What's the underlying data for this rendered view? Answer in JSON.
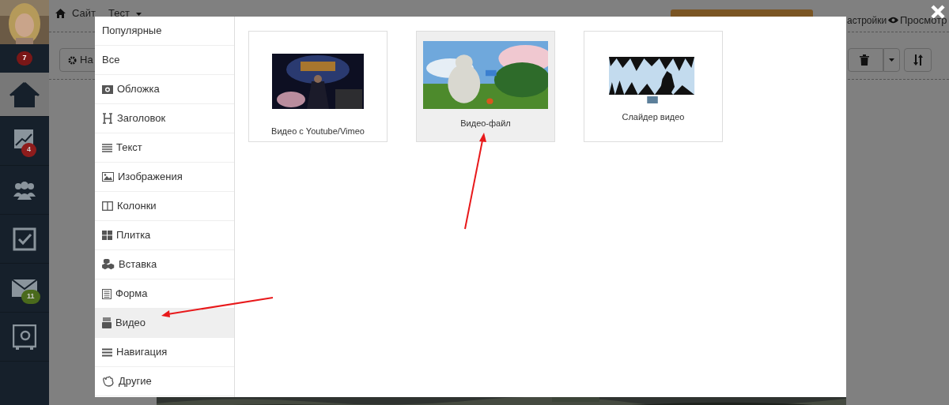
{
  "sidebar": {
    "profile_badge": "7",
    "items": [
      {
        "selected": true
      },
      {
        "selected": false,
        "badge": "4",
        "color": "#8e1c1c"
      },
      {
        "selected": false
      },
      {
        "selected": false
      },
      {
        "selected": false,
        "badge": "11",
        "color": "#4a6a1c"
      },
      {
        "selected": false
      }
    ]
  },
  "header": {
    "breadcrumbs": [
      "Сайт",
      "Тест"
    ],
    "settings": "астройки",
    "preview": "Просмотр"
  },
  "toolbar": {
    "settings_button": "На"
  },
  "modal": {
    "categories": [
      {
        "label": "Популярные",
        "selected": false
      },
      {
        "label": "Все",
        "selected": false
      },
      {
        "label": "Обложка",
        "selected": false
      },
      {
        "label": "Заголовок",
        "selected": false
      },
      {
        "label": "Текст",
        "selected": false
      },
      {
        "label": "Изображения",
        "selected": false
      },
      {
        "label": "Колонки",
        "selected": false
      },
      {
        "label": "Плитка",
        "selected": false
      },
      {
        "label": "Вставка",
        "selected": false
      },
      {
        "label": "Форма",
        "selected": false
      },
      {
        "label": "Видео",
        "selected": true
      },
      {
        "label": "Навигация",
        "selected": false
      },
      {
        "label": "Другие",
        "selected": false
      }
    ],
    "cards": [
      {
        "label": "Видео с Youtube/Vimeo",
        "selected": false
      },
      {
        "label": "Видео-файл",
        "selected": true
      },
      {
        "label": "Слайдер видео",
        "selected": false
      }
    ]
  }
}
